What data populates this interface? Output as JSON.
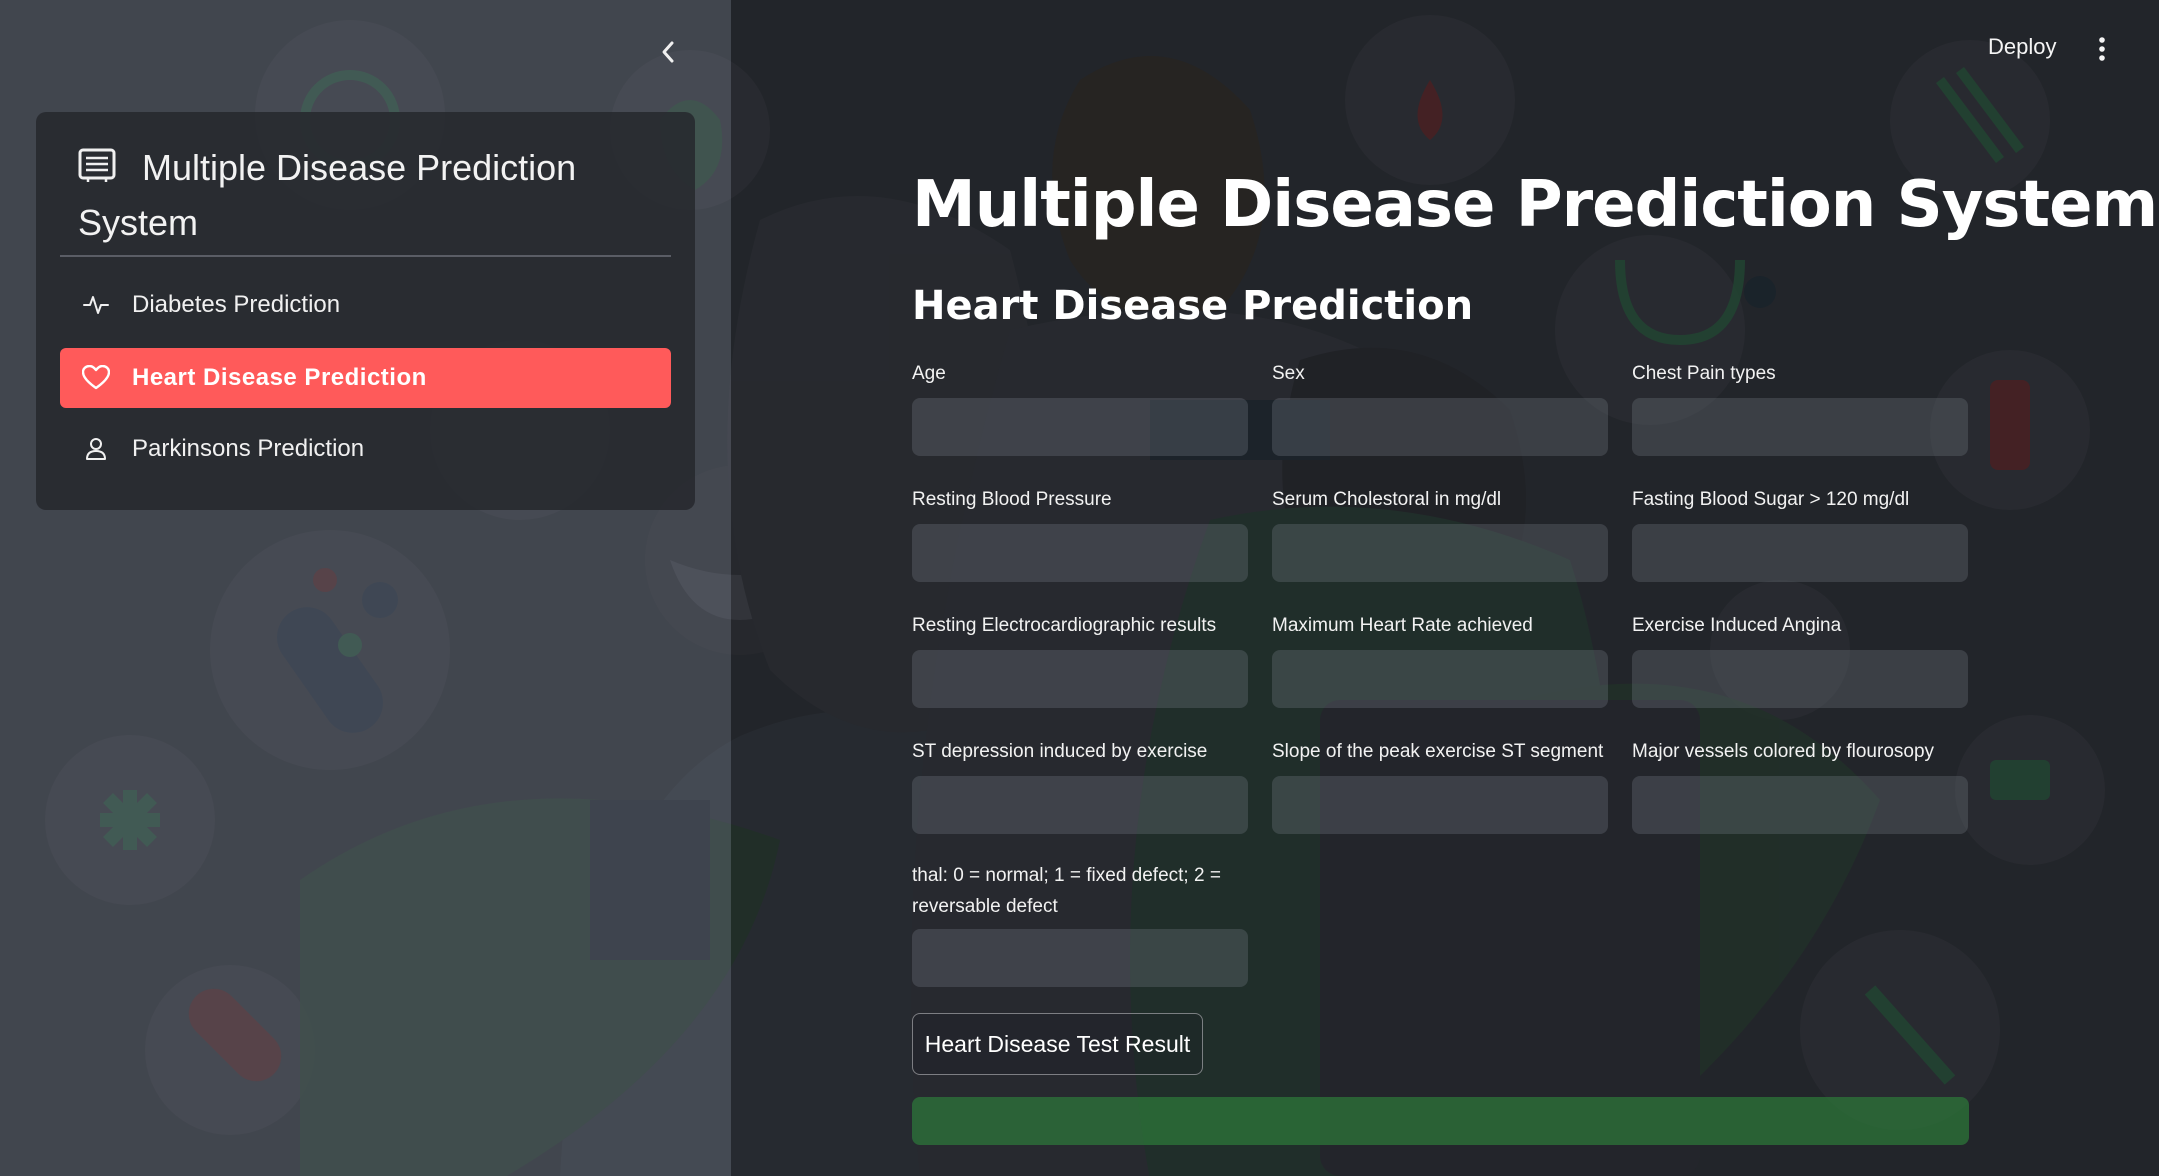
{
  "sidebar": {
    "collapse_icon": "chevron-left-icon",
    "menu_title": "Multiple Disease Prediction System",
    "menu_title_icon": "list-icon",
    "items": [
      {
        "label": "Diabetes Prediction",
        "icon": "activity-icon",
        "active": false
      },
      {
        "label": "Heart Disease Prediction",
        "icon": "heart-icon",
        "active": true
      },
      {
        "label": "Parkinsons Prediction",
        "icon": "person-icon",
        "active": false
      }
    ],
    "active_color": "#ff5a5a"
  },
  "header": {
    "deploy_label": "Deploy",
    "menu_icon": "kebab-menu-icon"
  },
  "main": {
    "title": "Multiple Disease Prediction System",
    "subtitle": "Heart Disease Prediction",
    "fields": [
      {
        "label": "Age",
        "value": ""
      },
      {
        "label": "Sex",
        "value": ""
      },
      {
        "label": "Chest Pain types",
        "value": ""
      },
      {
        "label": "Resting Blood Pressure",
        "value": ""
      },
      {
        "label": "Serum Cholestoral in mg/dl",
        "value": ""
      },
      {
        "label": "Fasting Blood Sugar > 120 mg/dl",
        "value": ""
      },
      {
        "label": "Resting Electrocardiographic results",
        "value": ""
      },
      {
        "label": "Maximum Heart Rate achieved",
        "value": ""
      },
      {
        "label": "Exercise Induced Angina",
        "value": ""
      },
      {
        "label": "ST depression induced by exercise",
        "value": ""
      },
      {
        "label": "Slope of the peak exercise ST segment",
        "value": ""
      },
      {
        "label": "Major vessels colored by flourosopy",
        "value": ""
      },
      {
        "label": "thal: 0 = normal; 1 = fixed defect; 2 = reversable defect",
        "value": ""
      }
    ],
    "button_label": "Heart Disease Test Result",
    "result_text": "",
    "result_color": "#2c783a"
  }
}
